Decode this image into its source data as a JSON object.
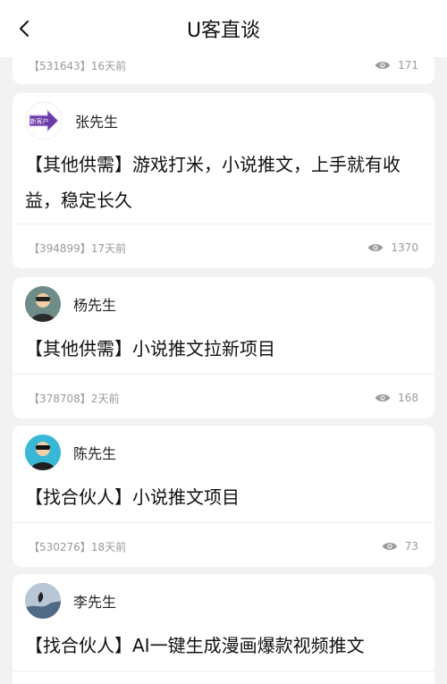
{
  "header": {
    "title": "U客直谈"
  },
  "posts": [
    {
      "meta_id": "【531643】",
      "time": "16天前",
      "views": "171"
    },
    {
      "name": "张先生",
      "content": "【其他供需】游戏打米，小说推文，上手就有收益，稳定长久",
      "meta_id": "【394899】",
      "time": "17天前",
      "views": "1370"
    },
    {
      "name": "杨先生",
      "content": "【其他供需】小说推文拉新项目",
      "meta_id": "【378708】",
      "time": "2天前",
      "views": "168"
    },
    {
      "name": "陈先生",
      "content": "【找合伙人】小说推文项目",
      "meta_id": "【530276】",
      "time": "18天前",
      "views": "73"
    },
    {
      "name": "李先生",
      "content": "【找合伙人】AI一键生成漫画爆款视频推文"
    }
  ],
  "badges": {
    "new_user_badge": "新客户"
  },
  "colors": {
    "eye": "#9a9a9a",
    "divider": "#eeeeee",
    "badge_purple": "#6a3aa6"
  }
}
